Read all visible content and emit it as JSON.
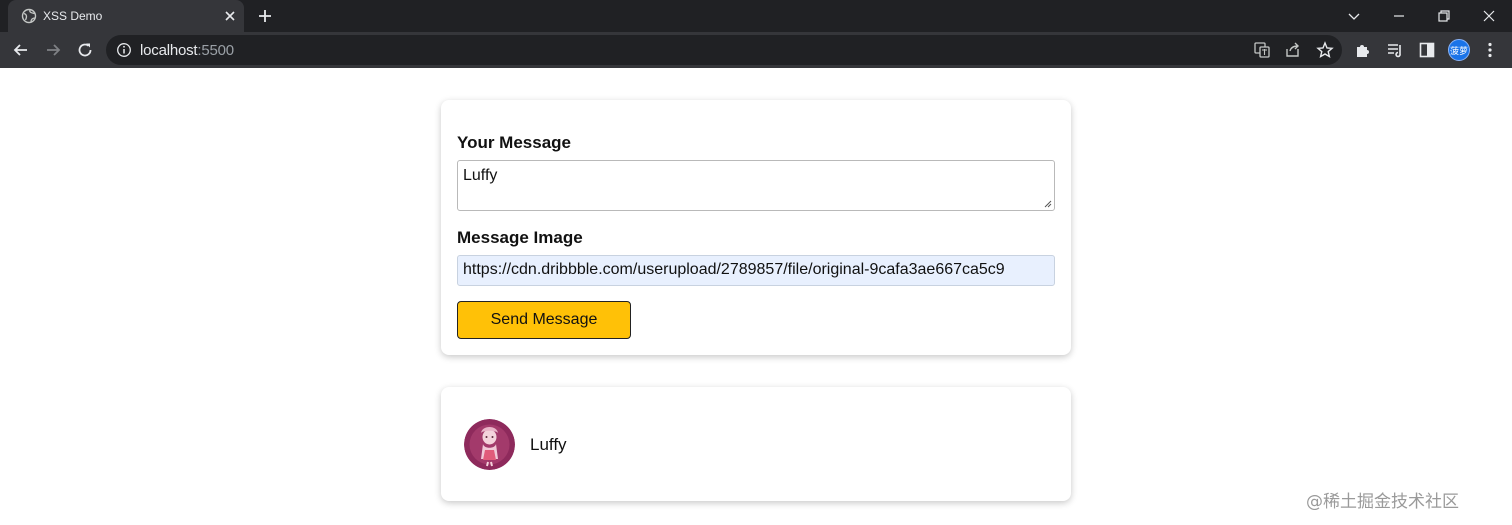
{
  "browser": {
    "tab_title": "XSS Demo",
    "url_host": "localhost",
    "url_port": ":5500",
    "profile_avatar_text": "菠萝"
  },
  "form": {
    "message_label": "Your Message",
    "message_value": "Luffy",
    "image_label": "Message Image",
    "image_value": "https://cdn.dribbble.com/userupload/2789857/file/original-9cafa3ae667ca5c9",
    "send_button_label": "Send Message"
  },
  "messages": [
    {
      "text": "Luffy"
    }
  ],
  "watermark": "@稀土掘金技术社区",
  "colors": {
    "button_bg": "#ffc107",
    "input_autofill_bg": "#e8f0fe",
    "chrome_dark": "#202124",
    "chrome_tab": "#35363a"
  }
}
